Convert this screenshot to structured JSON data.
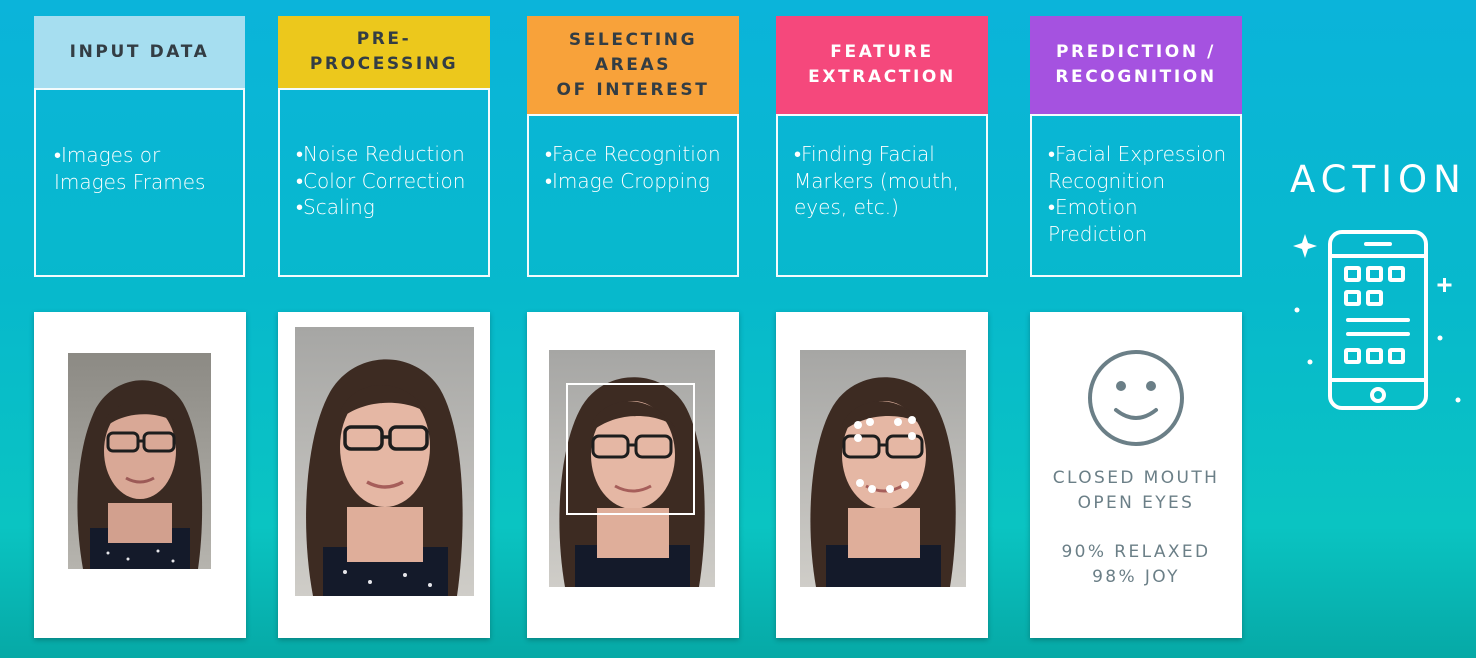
{
  "stages": [
    {
      "title": "INPUT DATA",
      "bullets": "•Images or\nImages Frames",
      "color": "#a6def0",
      "text_color": "#333d44"
    },
    {
      "title": "PRE-PROCESSING",
      "bullets": "•Noise Reduction\n•Color Correction\n•Scaling",
      "color": "#ecc81c",
      "text_color": "#333d44"
    },
    {
      "title": "SELECTING AREAS\nOF INTEREST",
      "bullets": "•Face Recognition\n•Image Cropping",
      "color": "#f8a23a",
      "text_color": "#333d44"
    },
    {
      "title": "FEATURE\nEXTRACTION",
      "bullets": "•Finding Facial\nMarkers (mouth,\neyes, etc.)",
      "color": "#f5487c",
      "text_color": "#ffffff"
    },
    {
      "title": "PREDICTION /\nRECOGNITION",
      "bullets": "•Facial Expression\nRecognition\n•Emotion\nPrediction",
      "color": "#a552e0",
      "text_color": "#ffffff"
    }
  ],
  "result": {
    "state": "CLOSED MOUTH\nOPEN EYES",
    "scores": "90% RELAXED\n98% JOY"
  },
  "action": {
    "title": "ACTION",
    "icon": "smartphone-app-icon"
  },
  "icons": {
    "smiley": "smiley-face-icon",
    "sparkle": "sparkle-icon"
  }
}
